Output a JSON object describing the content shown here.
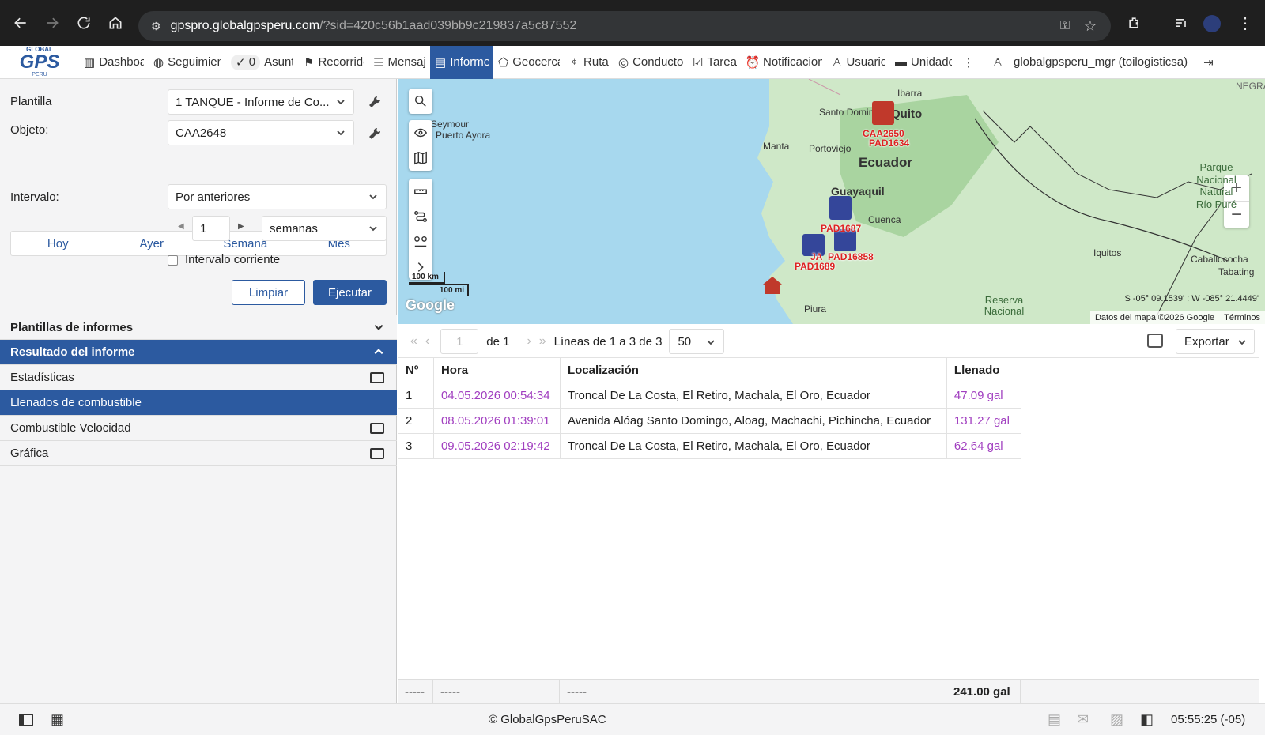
{
  "browser": {
    "url_host": "gpspro.globalgpsperu.com",
    "url_rest": "/?sid=420c56b1aad039bb9c219837a5c87552"
  },
  "nav": {
    "logo_top": "GLOBAL",
    "logo_main": "GPS",
    "logo_sub": "PERU",
    "items": [
      {
        "label": "Dashboard",
        "icon": "bar-chart-icon"
      },
      {
        "label": "Seguimiento",
        "icon": "globe-icon"
      },
      {
        "label": "Asuntos",
        "icon": "check-circle-icon",
        "badge": "0"
      },
      {
        "label": "Recorridos",
        "icon": "flag-icon"
      },
      {
        "label": "Mensajes",
        "icon": "list-icon"
      },
      {
        "label": "Informes",
        "icon": "report-icon",
        "active": true
      },
      {
        "label": "Geocercas",
        "icon": "geofence-icon"
      },
      {
        "label": "Rutas",
        "icon": "route-icon"
      },
      {
        "label": "Conductores",
        "icon": "steering-wheel-icon"
      },
      {
        "label": "Tareas",
        "icon": "task-icon"
      },
      {
        "label": "Notificaciones",
        "icon": "alarm-icon"
      },
      {
        "label": "Usuarios",
        "icon": "user-icon"
      },
      {
        "label": "Unidades",
        "icon": "bus-icon"
      }
    ],
    "user": "globalgpsperu_mgr (toilogisticsa)"
  },
  "form": {
    "plantilla_label": "Plantilla",
    "plantilla_value": "1 TANQUE - Informe de Co...",
    "objeto_label": "Objeto:",
    "objeto_value": "CAA2648",
    "tabs": [
      "Hoy",
      "Ayer",
      "Semana",
      "Mes"
    ],
    "intervalo_label": "Intervalo:",
    "intervalo_value": "Por anteriores",
    "count_value": "1",
    "unit_value": "semanas",
    "current_label": "Intervalo corriente",
    "clear_label": "Limpiar",
    "run_label": "Ejecutar"
  },
  "sections": {
    "templates": "Plantillas de informes",
    "result": "Resultado del informe",
    "items": [
      {
        "label": "Estadísticas",
        "active": false
      },
      {
        "label": "Llenados de combustible",
        "active": true
      },
      {
        "label": "Combustible Velocidad",
        "active": false
      },
      {
        "label": "Gráfica",
        "active": false
      }
    ]
  },
  "map": {
    "labels": [
      "Santo Domingo",
      "Manta",
      "Portoviejo",
      "Ecuador",
      "Guayaquil",
      "Cuenca",
      "Ibarra",
      "Quito",
      "Piura",
      "Iquitos",
      "Caballococha",
      "Tabating",
      "Parque Nacional Natural Río Puré",
      "Reserva Nacional",
      "Seymour",
      "Puerto Ayora",
      "NEGRA"
    ],
    "vehicles": [
      "CAA2650",
      "PAD1634",
      "PAD1687",
      "PAD16858",
      "JA",
      "PAD1689"
    ],
    "scale_km": "100 km",
    "scale_mi": "100 mi",
    "coords": "S -05° 09.1539' : W -085° 21.4449'",
    "attribution": "Datos del mapa ©2026 Google",
    "terms": "Términos",
    "google": "Google"
  },
  "pager": {
    "page": "1",
    "of": "de 1",
    "lines": "Líneas de 1 a 3 de 3",
    "per_page": "50",
    "export": "Exportar"
  },
  "table": {
    "headers": [
      "Nº",
      "Hora",
      "Localización",
      "Llenado"
    ],
    "rows": [
      {
        "n": "1",
        "time": "04.05.2026 00:54:34",
        "loc": "Troncal De La Costa, El Retiro, Machala, El Oro, Ecuador",
        "fill": "47.09 gal"
      },
      {
        "n": "2",
        "time": "08.05.2026 01:39:01",
        "loc": "Avenida Alóag Santo Domingo, Aloag, Machachi, Pichincha, Ecuador",
        "fill": "131.27 gal"
      },
      {
        "n": "3",
        "time": "09.05.2026 02:19:42",
        "loc": "Troncal De La Costa, El Retiro, Machala, El Oro, Ecuador",
        "fill": "62.64 gal"
      }
    ],
    "totals": [
      "-----",
      "-----",
      "-----",
      "241.00 gal"
    ]
  },
  "status": {
    "copyright": "© GlobalGpsPeruSAC",
    "clock": "05:55:25 (-05)"
  }
}
